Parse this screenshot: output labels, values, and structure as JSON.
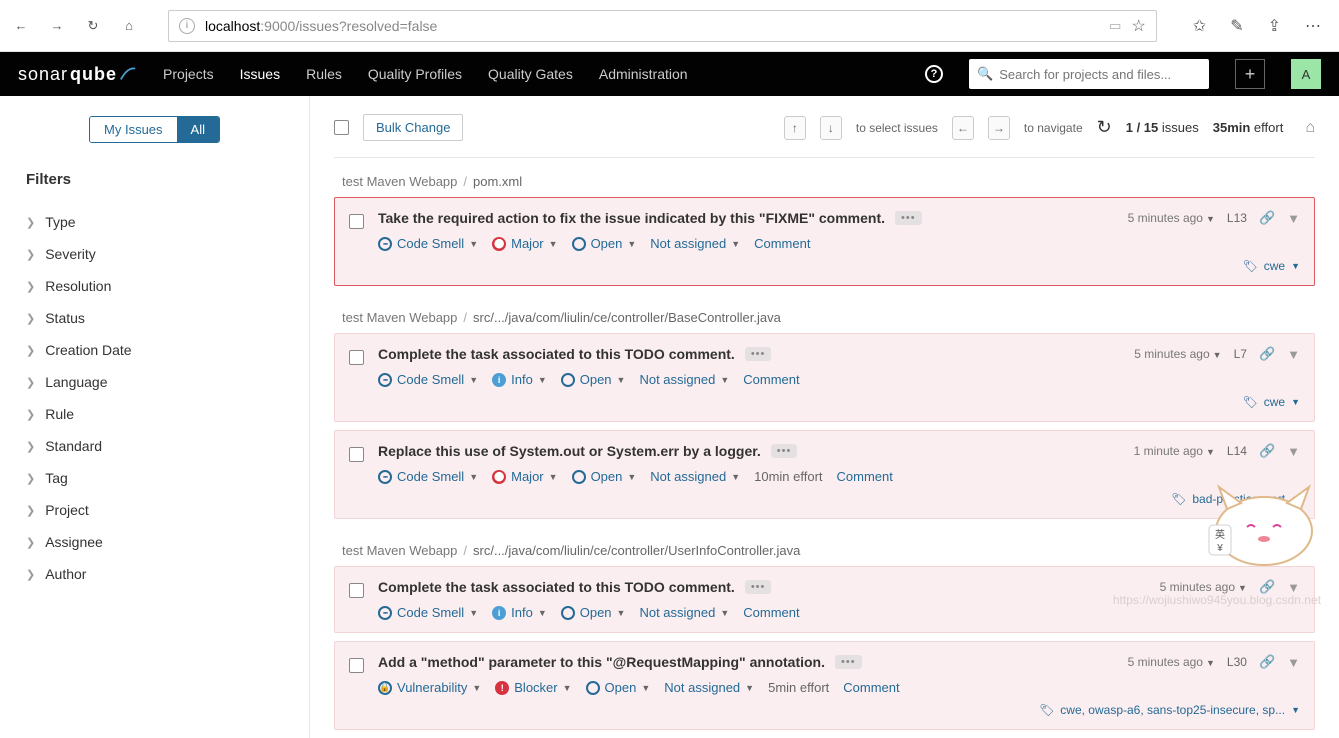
{
  "browser": {
    "url_host": "localhost",
    "url_port": ":9000",
    "url_path": "/issues?resolved=false"
  },
  "nav": {
    "brand_a": "sonar",
    "brand_b": "qube",
    "links": [
      "Projects",
      "Issues",
      "Rules",
      "Quality Profiles",
      "Quality Gates",
      "Administration"
    ],
    "search_placeholder": "Search for projects and files...",
    "avatar": "A"
  },
  "sidebar": {
    "toggle_my": "My Issues",
    "toggle_all": "All",
    "filters_title": "Filters",
    "facets": [
      "Type",
      "Severity",
      "Resolution",
      "Status",
      "Creation Date",
      "Language",
      "Rule",
      "Standard",
      "Tag",
      "Project",
      "Assignee",
      "Author"
    ]
  },
  "toolbar": {
    "bulk": "Bulk Change",
    "select_hint": "to select issues",
    "nav_hint": "to navigate",
    "count_cur": "1",
    "count_sep": " / ",
    "count_total": "15",
    "count_word": " issues",
    "effort_val": "35min",
    "effort_word": " effort"
  },
  "groups": [
    {
      "project": "test Maven Webapp",
      "file": "pom.xml",
      "issues": [
        {
          "selected": true,
          "title": "Take the required action to fix the issue indicated by this \"FIXME\" comment.",
          "time": "5 minutes ago",
          "line": "L13",
          "type": "Code Smell",
          "severity": "Major",
          "sev_ic": "major",
          "status": "Open",
          "assignee": "Not assigned",
          "effort": "",
          "comment": "Comment",
          "tags": "cwe"
        }
      ]
    },
    {
      "project": "test Maven Webapp",
      "file": "src/.../java/com/liulin/ce/controller/BaseController.java",
      "issues": [
        {
          "title": "Complete the task associated to this TODO comment.",
          "time": "5 minutes ago",
          "line": "L7",
          "type": "Code Smell",
          "severity": "Info",
          "sev_ic": "info",
          "status": "Open",
          "assignee": "Not assigned",
          "effort": "",
          "comment": "Comment",
          "tags": "cwe"
        },
        {
          "title": "Replace this use of System.out or System.err by a logger.",
          "time": "1 minute ago",
          "line": "L14",
          "type": "Code Smell",
          "severity": "Major",
          "sev_ic": "major",
          "status": "Open",
          "assignee": "Not assigned",
          "effort": "10min effort",
          "comment": "Comment",
          "tags": "bad-practice, cert"
        }
      ]
    },
    {
      "project": "test Maven Webapp",
      "file": "src/.../java/com/liulin/ce/controller/UserInfoController.java",
      "issues": [
        {
          "title": "Complete the task associated to this TODO comment.",
          "time": "5 minutes ago",
          "line": "",
          "type": "Code Smell",
          "severity": "Info",
          "sev_ic": "info",
          "status": "Open",
          "assignee": "Not assigned",
          "effort": "",
          "comment": "Comment",
          "tags": ""
        },
        {
          "title": "Add a \"method\" parameter to this \"@RequestMapping\" annotation.",
          "time": "5 minutes ago",
          "line": "L30",
          "type": "Vulnerability",
          "type_ic": "vuln",
          "severity": "Blocker",
          "sev_ic": "blocker",
          "status": "Open",
          "assignee": "Not assigned",
          "effort": "5min effort",
          "comment": "Comment",
          "tags": "cwe, owasp-a6, sans-top25-insecure, sp..."
        }
      ]
    }
  ],
  "watermark": "https://wojiushiwo945you.blog.csdn.net"
}
